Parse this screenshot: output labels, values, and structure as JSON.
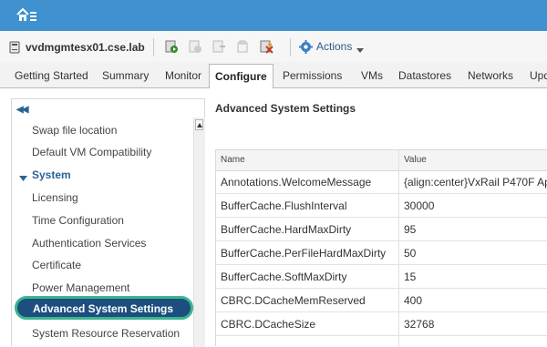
{
  "colors": {
    "topbar": "#3f91cf",
    "selected_bg": "#1c4e7f",
    "highlight_ring": "#3db58f",
    "link": "#2a6496"
  },
  "topbar": {
    "icon": "home-menu-icon"
  },
  "toolbar": {
    "host": "vvdmgmtesx01.cse.lab",
    "actions_label": "Actions",
    "icons": [
      "host-icon",
      "power-on-icon",
      "power-off-icon",
      "enter-maintenance-icon",
      "exit-maintenance-icon",
      "settings-icon",
      "gear-icon",
      "chevron-down-icon"
    ]
  },
  "tabs": [
    {
      "label": "Getting Started"
    },
    {
      "label": "Summary"
    },
    {
      "label": "Monitor"
    },
    {
      "label": "Configure",
      "active": true
    },
    {
      "label": "Permissions"
    },
    {
      "label": "VMs"
    },
    {
      "label": "Datastores"
    },
    {
      "label": "Networks"
    },
    {
      "label": "Upd"
    }
  ],
  "sidebar": {
    "collapse_icon": "double-chevron-left-icon",
    "items_top": [
      "Swap file location",
      "Default VM Compatibility"
    ],
    "group": "System",
    "items": [
      "Licensing",
      "Time Configuration",
      "Authentication Services",
      "Certificate",
      "Power Management"
    ],
    "selected": "Advanced System Settings",
    "item_after": "System Resource Reservation"
  },
  "main": {
    "title": "Advanced System Settings",
    "columns": [
      "Name",
      "Value"
    ],
    "rows": [
      {
        "name": "Annotations.WelcomeMessage",
        "value": "{align:center}VxRail P470F Ap"
      },
      {
        "name": "BufferCache.FlushInterval",
        "value": "30000"
      },
      {
        "name": "BufferCache.HardMaxDirty",
        "value": "95"
      },
      {
        "name": "BufferCache.PerFileHardMaxDirty",
        "value": "50"
      },
      {
        "name": "BufferCache.SoftMaxDirty",
        "value": "15"
      },
      {
        "name": "CBRC.DCacheMemReserved",
        "value": "400"
      },
      {
        "name": "CBRC.DCacheSize",
        "value": "32768"
      }
    ]
  }
}
